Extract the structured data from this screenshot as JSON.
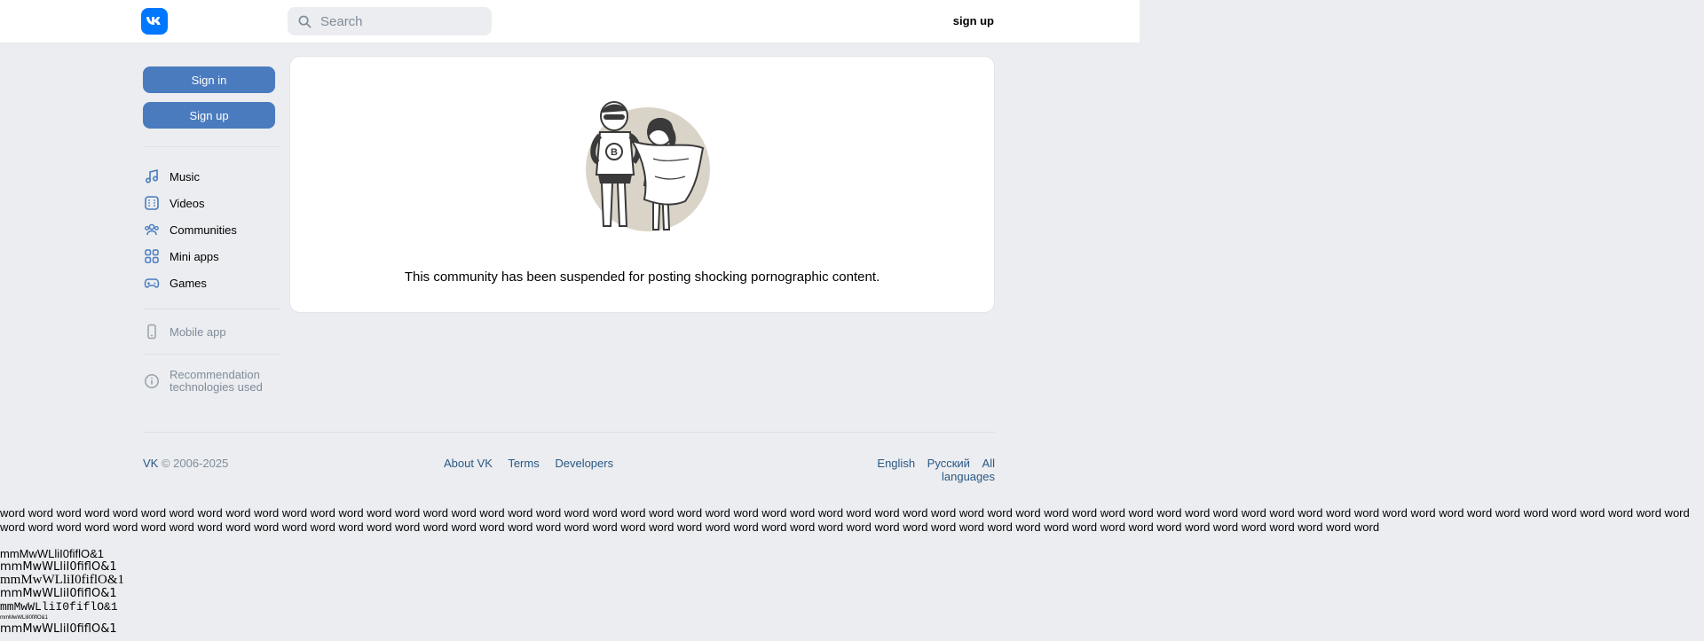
{
  "header": {
    "logo_text": "VK",
    "search_placeholder": "Search",
    "signup_label": "sign up"
  },
  "sidebar": {
    "signin_label": "Sign in",
    "signup_label": "Sign up",
    "nav": [
      {
        "label": "Music",
        "icon": "music-note-icon"
      },
      {
        "label": "Videos",
        "icon": "video-icon"
      },
      {
        "label": "Communities",
        "icon": "users-icon"
      },
      {
        "label": "Mini apps",
        "icon": "apps-grid-icon"
      },
      {
        "label": "Games",
        "icon": "gamepad-icon"
      }
    ],
    "mobile_app": "Mobile app",
    "recommendation": "Recommendation technologies used"
  },
  "main": {
    "message": "This community has been suspended for posting shocking pornographic content."
  },
  "footer": {
    "brand": "VK",
    "copyright": " © 2006-2025",
    "links": [
      "About VK",
      "Terms",
      "Developers"
    ],
    "languages": [
      "English",
      "Русский",
      "All languages"
    ]
  },
  "probe": {
    "words": "word word word word word word word word word word word word word word word word word word word word word word word word word word word word word word word word word word word word word word word word word word word word word word word word word word word word word word word word word word word word word word word word word word word word word word word word word word word word word word word word word word word word word word word word word word word word word word word word word word word word word word word word word word word word word",
    "line1": "mmMwWLliI0fiflO&1",
    "line2": "mmMwWLliI0fiflO&1",
    "line3": "mmMwWLliI0fiflO&1",
    "line4": "mmMwWLliI0fiflO&1",
    "line5": "mmMwWLliI0fiflO&1",
    "line6": "mmMwWLliI0fiflO&1",
    "line7": "mmMwWLliI0fiflO&1"
  },
  "colors": {
    "accent": "#4a7bbf",
    "logo": "#0077ff",
    "link": "#2a5885",
    "muted": "#818c99",
    "background": "#ebedf0"
  }
}
